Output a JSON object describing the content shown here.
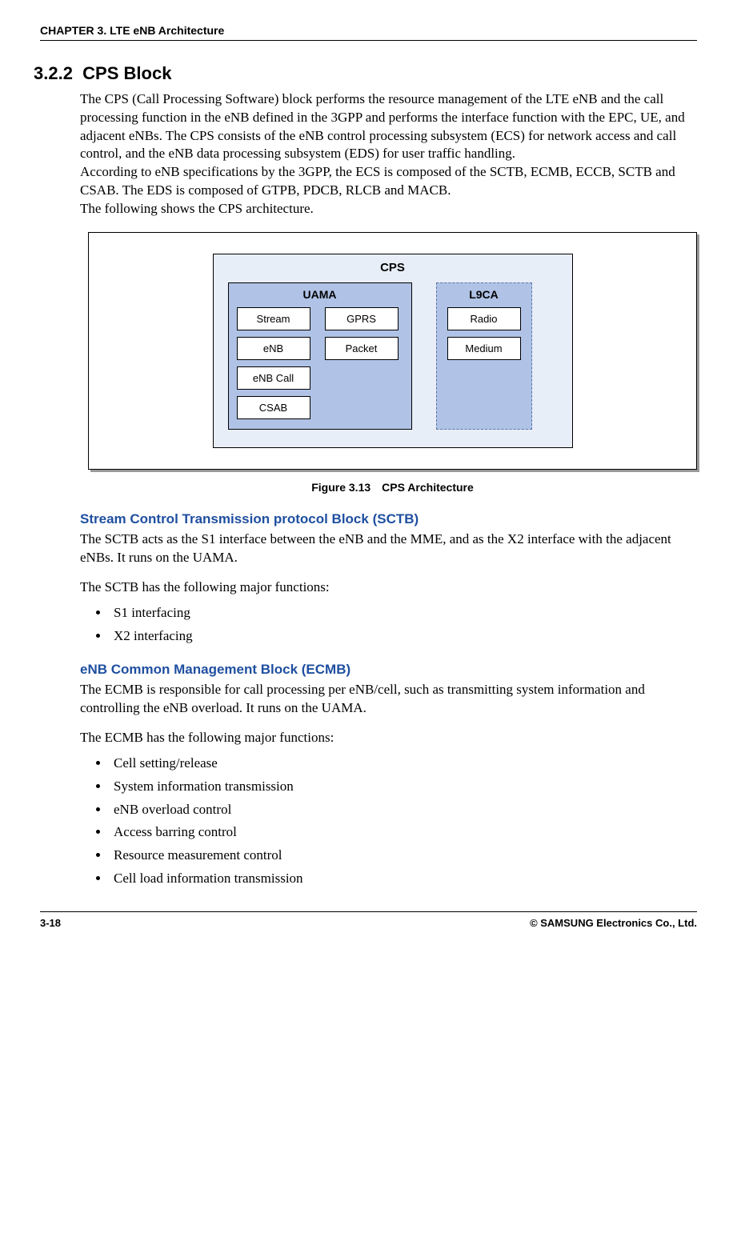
{
  "header": {
    "chapter": "CHAPTER 3. LTE eNB Architecture"
  },
  "section": {
    "number": "3.2.2",
    "title": "CPS Block"
  },
  "intro": {
    "p1": "The CPS (Call Processing Software) block performs the resource management of the LTE eNB and the call processing function in the eNB defined in the 3GPP and performs the interface function with the EPC, UE, and adjacent eNBs. The CPS consists of the eNB control processing subsystem (ECS) for network access and call control, and the eNB data processing subsystem (EDS) for user traffic handling.",
    "p2": "According to eNB specifications by the 3GPP, the ECS is composed of the SCTB, ECMB, ECCB, SCTB and CSAB. The EDS is composed of GTPB, PDCB, RLCB and MACB.",
    "p3": "The following shows the CPS architecture."
  },
  "diagram": {
    "cps": "CPS",
    "uama": {
      "title": "UAMA",
      "b1": "Stream",
      "b2": "GPRS",
      "b3": "eNB",
      "b4": "Packet",
      "b5": "eNB Call",
      "b6": "CSAB"
    },
    "l9ca": {
      "title": "L9CA",
      "b1": "Radio",
      "b2": "Medium"
    }
  },
  "figure_caption": "Figure 3.13 CPS Architecture",
  "sctb": {
    "heading": "Stream Control Transmission protocol Block (SCTB)",
    "p1": "The SCTB acts as the S1 interface between the eNB and the MME, and as the X2 interface with the adjacent eNBs. It runs on the UAMA.",
    "p2": "The SCTB has the following major functions:",
    "items": [
      "S1 interfacing",
      "X2 interfacing"
    ]
  },
  "ecmb": {
    "heading": "eNB Common Management Block (ECMB)",
    "p1": "The ECMB is responsible for call processing per eNB/cell, such as transmitting system information and controlling the eNB overload. It runs on the UAMA.",
    "p2": "The ECMB has the following major functions:",
    "items": [
      "Cell setting/release",
      "System information transmission",
      "eNB overload control",
      "Access barring control",
      "Resource measurement control",
      "Cell load information transmission"
    ]
  },
  "footer": {
    "page": "3-18",
    "copyright": "© SAMSUNG Electronics Co., Ltd."
  }
}
